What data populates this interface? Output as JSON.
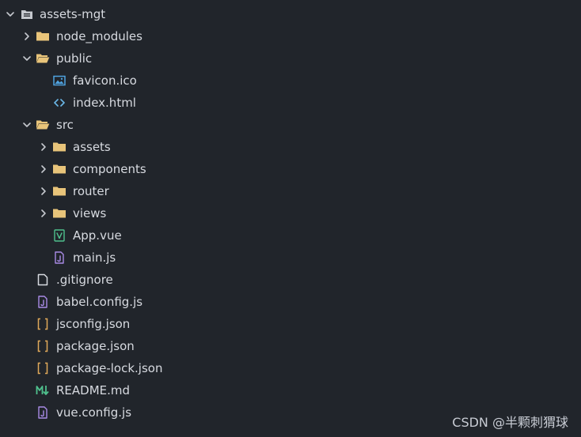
{
  "explorer": {
    "items": [
      {
        "label": "assets-mgt",
        "depth": 0,
        "kind": "root",
        "expanded": true
      },
      {
        "label": "node_modules",
        "depth": 1,
        "kind": "folder",
        "expanded": false
      },
      {
        "label": "public",
        "depth": 1,
        "kind": "folder",
        "expanded": true
      },
      {
        "label": "favicon.ico",
        "depth": 2,
        "kind": "image"
      },
      {
        "label": "index.html",
        "depth": 2,
        "kind": "html"
      },
      {
        "label": "src",
        "depth": 1,
        "kind": "folder",
        "expanded": true
      },
      {
        "label": "assets",
        "depth": 2,
        "kind": "folder",
        "expanded": false
      },
      {
        "label": "components",
        "depth": 2,
        "kind": "folder",
        "expanded": false
      },
      {
        "label": "router",
        "depth": 2,
        "kind": "folder",
        "expanded": false
      },
      {
        "label": "views",
        "depth": 2,
        "kind": "folder",
        "expanded": false
      },
      {
        "label": "App.vue",
        "depth": 2,
        "kind": "vue"
      },
      {
        "label": "main.js",
        "depth": 2,
        "kind": "js"
      },
      {
        "label": ".gitignore",
        "depth": 1,
        "kind": "file"
      },
      {
        "label": "babel.config.js",
        "depth": 1,
        "kind": "js"
      },
      {
        "label": "jsconfig.json",
        "depth": 1,
        "kind": "json"
      },
      {
        "label": "package.json",
        "depth": 1,
        "kind": "json"
      },
      {
        "label": "package-lock.json",
        "depth": 1,
        "kind": "json"
      },
      {
        "label": "README.md",
        "depth": 1,
        "kind": "markdown"
      },
      {
        "label": "vue.config.js",
        "depth": 1,
        "kind": "js"
      }
    ]
  },
  "watermark": "CSDN @半颗刺猬球",
  "colors": {
    "background": "#21252b",
    "text": "#d7dae0",
    "folder": "#e8c47a",
    "image_icon": "#4fa3e0",
    "html_icon": "#6bb8e8",
    "vue_icon": "#4fc08d",
    "js_icon": "#a98be6",
    "json_icon": "#e0a85a",
    "markdown_icon": "#4fc08d",
    "file_icon": "#d7dae0"
  }
}
